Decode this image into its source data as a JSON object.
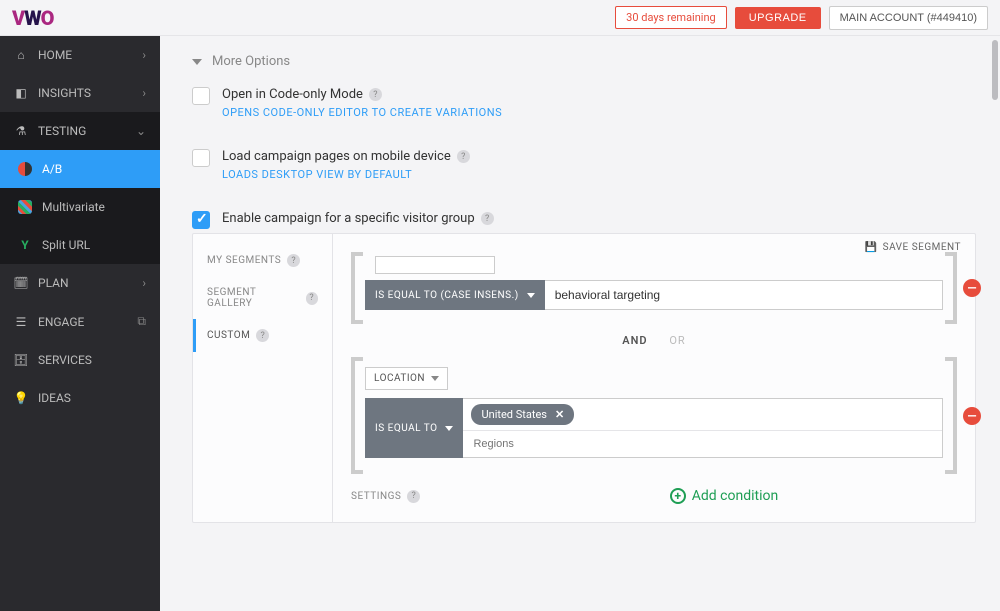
{
  "header": {
    "trial": "30 days remaining",
    "upgrade": "UPGRADE",
    "account": "MAIN ACCOUNT (#449410)"
  },
  "sidebar": {
    "home": "HOME",
    "insights": "INSIGHTS",
    "testing": "TESTING",
    "ab": "A/B",
    "multivariate": "Multivariate",
    "split_url": "Split URL",
    "plan": "PLAN",
    "engage": "ENGAGE",
    "services": "SERVICES",
    "ideas": "IDEAS"
  },
  "more_options_title": "More Options",
  "opt1": {
    "label": "Open in Code-only Mode",
    "sub": "OPENS CODE-ONLY EDITOR TO CREATE VARIATIONS"
  },
  "opt2": {
    "label": "Load campaign pages on mobile device",
    "sub": "LOADS DESKTOP VIEW BY DEFAULT"
  },
  "opt3": {
    "label": "Enable campaign for a specific visitor group"
  },
  "segment": {
    "tab_my": "MY SEGMENTS",
    "tab_gallery": "SEGMENT GALLERY",
    "tab_custom": "CUSTOM",
    "save": "SAVE SEGMENT",
    "cond1": {
      "op": "IS EQUAL TO (CASE INSENS.)",
      "value": "behavioral targeting"
    },
    "logic": {
      "and": "AND",
      "or": "OR"
    },
    "cond2": {
      "field": "LOCATION",
      "op": "IS EQUAL TO",
      "tag": "United States",
      "placeholder": "Regions"
    },
    "settings": "SETTINGS",
    "add_condition": "Add condition"
  }
}
